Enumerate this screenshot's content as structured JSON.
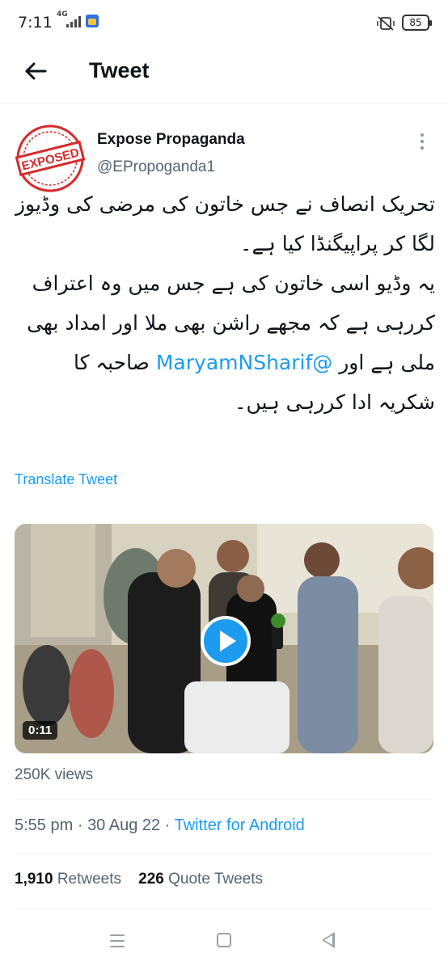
{
  "status_bar": {
    "time": "7:11",
    "network": "4G",
    "battery": "85",
    "icons": [
      "signal-icon",
      "app-notification-icon",
      "vibrate-off-icon",
      "battery-icon"
    ]
  },
  "header": {
    "title": "Tweet",
    "back_icon": "arrow-left-icon"
  },
  "tweet": {
    "author_name": "Expose Propaganda",
    "author_handle": "@EPropoganda1",
    "avatar_stamp_text": "EXPOSED",
    "text_before_mention": "تحریک انصاف نے جس خاتون کی مرضی کی وڈیوز لگا کر پراپیگنڈا کیا ہے۔\nیہ وڈیو اسی خاتون کی ہے جس میں وہ اعتراف کررہی ہے کہ مجھے راشن بھی ملا اور امداد بھی ملی ہے اور ",
    "mention": "@MaryamNSharif",
    "text_after_mention": " صاحبہ کا شکریہ ادا کررہی ہیں۔",
    "translate_label": "Translate Tweet",
    "video_duration": "0:11",
    "views": "250K views",
    "time": "5:55 pm",
    "date": "30 Aug 22",
    "separator": "·",
    "source": "Twitter for Android",
    "retweets_count": "1,910",
    "retweets_label": "Retweets",
    "quote_count": "226",
    "quote_label": "Quote Tweets"
  },
  "colors": {
    "accent": "#1d9bf0",
    "secondary_text": "#536471",
    "primary_text": "#0f1419",
    "stamp_red": "#d62b2b"
  }
}
